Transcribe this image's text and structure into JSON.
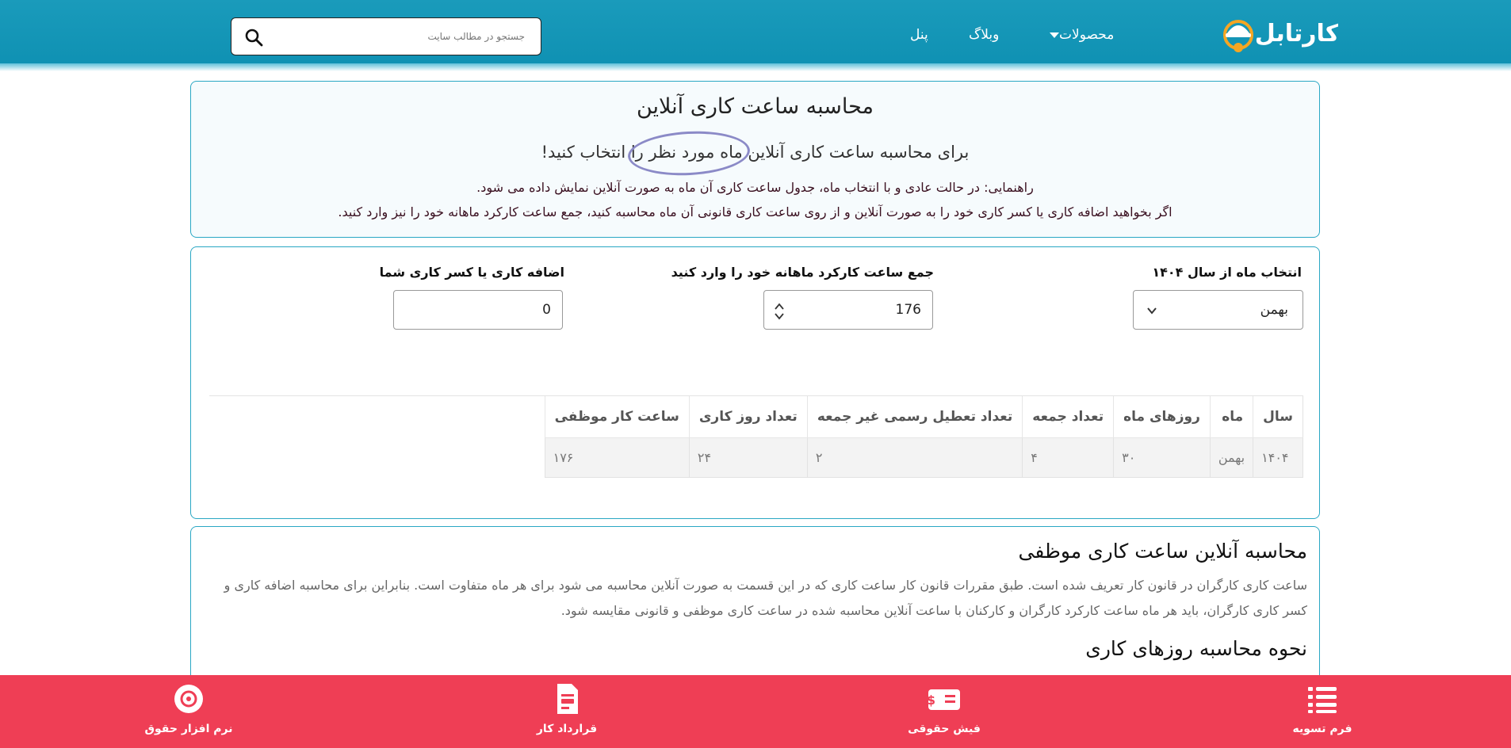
{
  "header": {
    "logo_text": "کارتابل",
    "nav": {
      "products": "محصولات",
      "blog": "وبلاگ",
      "panel": "پنل"
    },
    "search_placeholder": "جستجو در مطالب سایت"
  },
  "intro": {
    "title": "محاسبه ساعت کاری آنلاین",
    "subtitle": "برای محاسبه ساعت کاری آنلاین ماه مورد نظر را انتخاب کنید!",
    "guide1": "راهنمایی: در حالت عادی و با انتخاب ماه، جدول ساعت کاری آن ماه به صورت آنلاین نمایش داده می شود.",
    "guide2": "اگر بخواهید اضافه کاری یا کسر کاری خود را به صورت آنلاین و از روی ساعت کاری قانونی آن ماه محاسبه کنید، جمع ساعت کارکرد ماهانه خود را نیز وارد کنید."
  },
  "calculator": {
    "month_label": "انتخاب ماه از سال ۱۴۰۴",
    "month_value": "بهمن",
    "hours_label": "جمع ساعت کارکرد ماهانه خود را وارد کنید",
    "hours_value": "176",
    "overtime_label": "اضافه کاری یا کسر کاری شما",
    "overtime_value": "0"
  },
  "table": {
    "headers": [
      "سال",
      "ماه",
      "روزهای ماه",
      "تعداد جمعه",
      "تعداد تعطیل رسمی غیر جمعه",
      "تعداد روز کاری",
      "ساعت کار موظفی"
    ],
    "row": [
      "۱۴۰۴",
      "بهمن",
      "۳۰",
      "۴",
      "۲",
      "۲۴",
      "۱۷۶"
    ]
  },
  "article": {
    "heading1": "محاسبه آنلاین ساعت کاری موظفی",
    "paragraph1": "ساعت کاری کارگران در قانون کار تعریف شده است. طبق مقررات قانون کار ساعت کاری که در این قسمت به صورت آنلاین محاسبه می شود برای هر ماه متفاوت است. بنابراین برای محاسبه اضافه کاری و کسر کاری کارگران، باید هر ماه ساعت کارکرد کارگران و کارکنان با ساعت آنلاین محاسبه شده در ساعت کاری موظفی و قانونی مقایسه شود.",
    "heading2": "نحوه محاسبه روزهای کاری"
  },
  "bottom_bar": {
    "settlement": "فرم تسویه",
    "salary_slip": "فیش حقوقی",
    "contract": "قرارداد کار",
    "payroll_software": "نرم افزار حقوق"
  },
  "colors": {
    "header_bg": "#0e90b2",
    "card_border": "#2aa7c4",
    "bottom_bar": "#ef3e55",
    "logo_orange": "#f5a623"
  }
}
